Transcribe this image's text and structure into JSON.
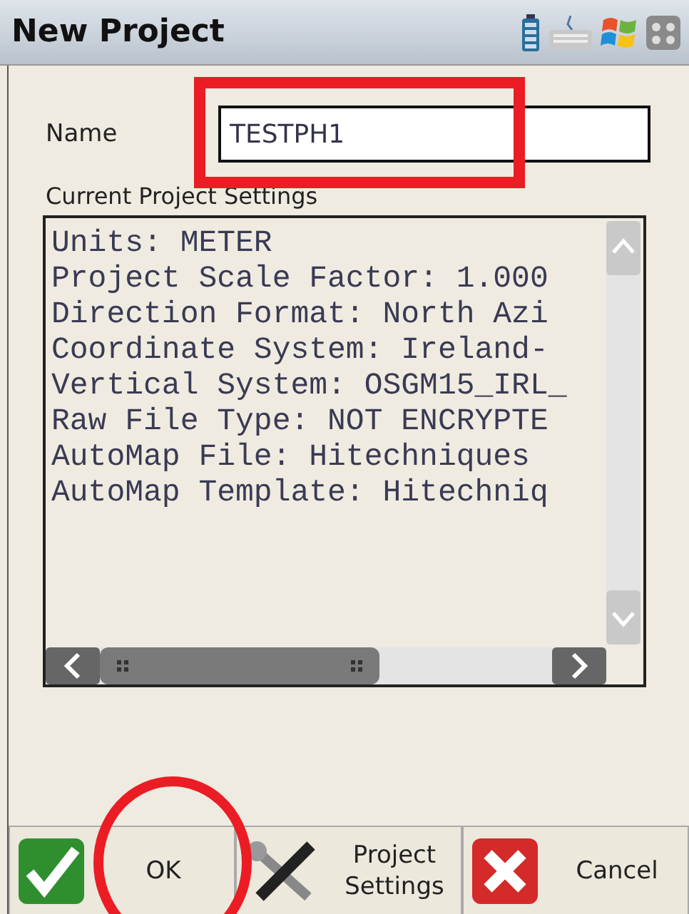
{
  "window": {
    "title": "New Project"
  },
  "name_field": {
    "label": "Name",
    "value": "TESTPH1"
  },
  "settings": {
    "heading": "Current Project Settings",
    "lines": [
      "Units: METER",
      "Project Scale Factor: 1.000",
      "Direction Format: North Azi",
      "Coordinate System: Ireland-",
      "Vertical System: OSGM15_IRL_",
      "Raw File Type: NOT ENCRYPTE",
      "AutoMap File: Hitechniques",
      "AutoMap Template: Hitechniq"
    ]
  },
  "buttons": [
    {
      "kind": "ok",
      "label": "OK"
    },
    {
      "kind": "settings",
      "label": "Project Settings"
    },
    {
      "kind": "cancel",
      "label": "Cancel"
    }
  ]
}
